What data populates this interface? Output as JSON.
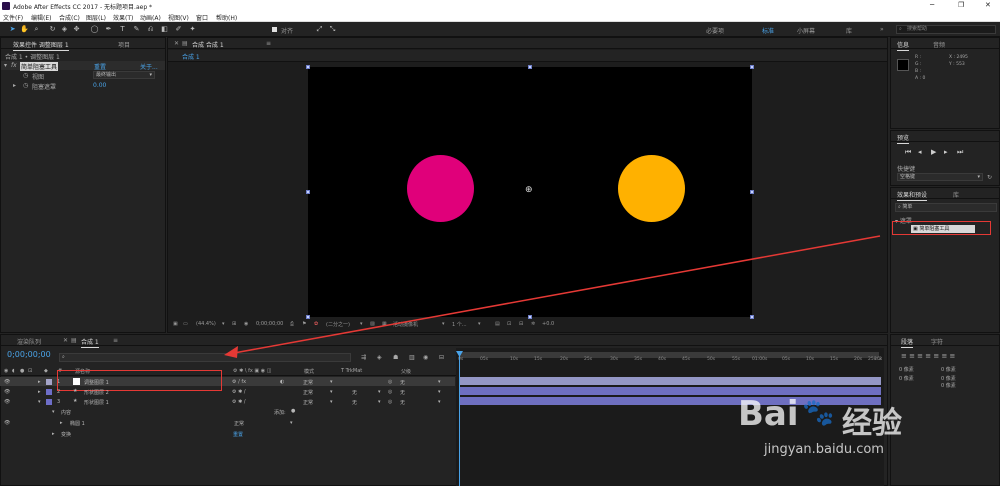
{
  "window": {
    "title": "Adobe After Effects CC 2017 - 无标题项目.aep *",
    "minimize": "─",
    "maximize": "❐",
    "close": "✕"
  },
  "menu": [
    "文件(F)",
    "编辑(E)",
    "合成(C)",
    "图层(L)",
    "效果(T)",
    "动画(A)",
    "视图(V)",
    "窗口",
    "帮助(H)"
  ],
  "toolbar": {
    "snap_label": "对齐",
    "workspaces": [
      "必要项",
      "标准",
      "小屏幕",
      "库"
    ],
    "active_workspace": "标准",
    "search_placeholder": "搜索帮助",
    "more": "»"
  },
  "effect_controls": {
    "tabs": [
      "效果控件 调整图层 1",
      "项目"
    ],
    "breadcrumb": "合成 1 • 调整图层 1",
    "effect_name": "简单阻塞工具",
    "reset": "重置",
    "about": "关于...",
    "props": [
      {
        "name": "视图",
        "value": "最终输出"
      },
      {
        "name": "阻塞遮罩",
        "value": "0.00"
      }
    ]
  },
  "composition": {
    "tab": "合成 合成 1",
    "sub_tab": "合成 1",
    "zoom": "(44.4%)",
    "timecode": "0;00;00;00",
    "resolution": "(二分之一)",
    "camera": "活动摄像机",
    "views": "1 个...",
    "exposure": "+0.0"
  },
  "info": {
    "tabs": [
      "信息",
      "音频"
    ],
    "r": "R :",
    "g": "G :",
    "b": "B :",
    "a": "A : 0",
    "x": "X : 2495",
    "y": "Y : 553"
  },
  "preview": {
    "tab": "预览",
    "shortcut_label": "快捷键",
    "shortcut_value": "空格键"
  },
  "effects_presets": {
    "tabs": [
      "效果和预设",
      "库"
    ],
    "search_value": "简单",
    "category": "▾ 遮罩",
    "result": "简单阻塞工具"
  },
  "timeline": {
    "tabs": [
      "渲染队列",
      "合成 1"
    ],
    "timecode": "0;00;00;00",
    "search_placeholder": "",
    "col_source": "源名称",
    "col_mode": "模式",
    "col_trkmat": "T TrkMat",
    "col_parent": "父级",
    "layers": [
      {
        "num": "1",
        "name": "调整图层 1",
        "mode": "正常",
        "trkmat": "",
        "parent": "无"
      },
      {
        "num": "2",
        "name": "形状图层 2",
        "mode": "正常",
        "trkmat": "无",
        "parent": "无"
      },
      {
        "num": "3",
        "name": "形状图层 1",
        "mode": "正常",
        "trkmat": "无",
        "parent": "无"
      }
    ],
    "contents_label": "内容",
    "add_label": "添加:",
    "ellipse_label": "椭圆 1",
    "ellipse_mode": "正常",
    "transform_label": "变换",
    "reset_label": "重置",
    "ruler": [
      "0s",
      "05s",
      "10s",
      "15s",
      "20s",
      "25s",
      "30s",
      "35s",
      "40s",
      "45s",
      "50s",
      "55s",
      "01:00s",
      "05s",
      "10s",
      "15s",
      "20s",
      "25s",
      "30s",
      "2"
    ]
  },
  "paragraph": {
    "tabs": [
      "段落",
      "字符"
    ],
    "values": [
      "0 像素",
      "0 像素",
      "0 像素",
      "0 像素",
      "0 像素"
    ]
  },
  "colors": {
    "accent": "#4aa3e8",
    "pink": "#e0007a",
    "orange": "#ffb100",
    "arrow": "#e53935",
    "track": "#8c8fc4"
  },
  "watermark": {
    "line1": "Bai",
    "line2": "经验",
    "url": "jingyan.baidu.com"
  }
}
